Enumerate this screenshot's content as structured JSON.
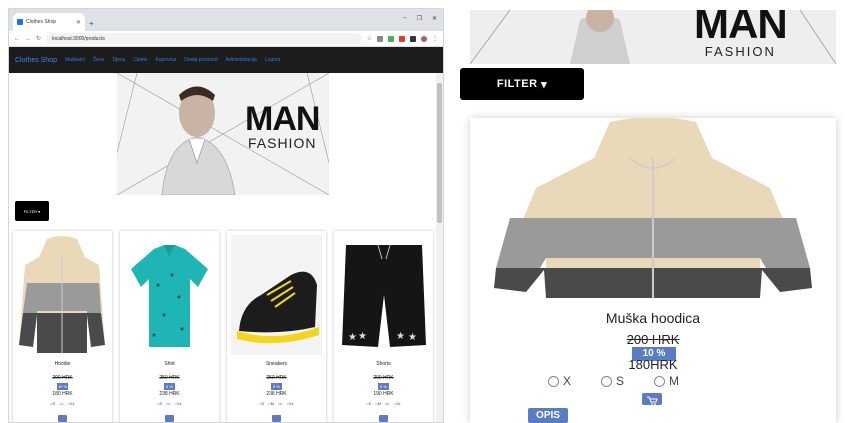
{
  "browser": {
    "tab_title": "Clothes Shop",
    "url": "localhost:3000/products"
  },
  "navbar": {
    "brand": "Clothes Shop",
    "items": [
      "Muškarci",
      "Žene",
      "Djeca",
      "Cipele",
      "Kupovina",
      "Dodaj proizvod",
      "Administracija",
      "Logout"
    ]
  },
  "filter_label": "FILTER",
  "hero": {
    "logo_main": "MAN",
    "logo_sub": "FASHION"
  },
  "products": [
    {
      "name": "Hoodie",
      "old_price": "200 HRK",
      "discount": "10 %",
      "new_price": "180 HRK",
      "sizes": [
        "S",
        "L",
        "XL"
      ]
    },
    {
      "name": "Shirt",
      "old_price": "250 HRK",
      "discount": "5 %",
      "new_price": "238 HRK",
      "sizes": [
        "S",
        "L",
        "XL"
      ]
    },
    {
      "name": "Sneakers",
      "old_price": "250 HRK",
      "discount": "5 %",
      "new_price": "238 HRK",
      "sizes": [
        "S",
        "M",
        "L",
        "XL"
      ]
    },
    {
      "name": "Shorts",
      "old_price": "200 HRK",
      "discount": "5 %",
      "new_price": "190 HRK",
      "sizes": [
        "S",
        "M",
        "L",
        "XL"
      ]
    }
  ],
  "zoom": {
    "name": "Muška hoodica",
    "old_price": "200 HRK",
    "discount": "10 %",
    "new_price": "180HRK",
    "sizes": [
      "X",
      "S",
      "M"
    ],
    "opis": "OPIS"
  },
  "colors": {
    "accent": "#5a7cc4",
    "nav_bg": "#1c1c1c",
    "brand": "#3b82f6"
  }
}
